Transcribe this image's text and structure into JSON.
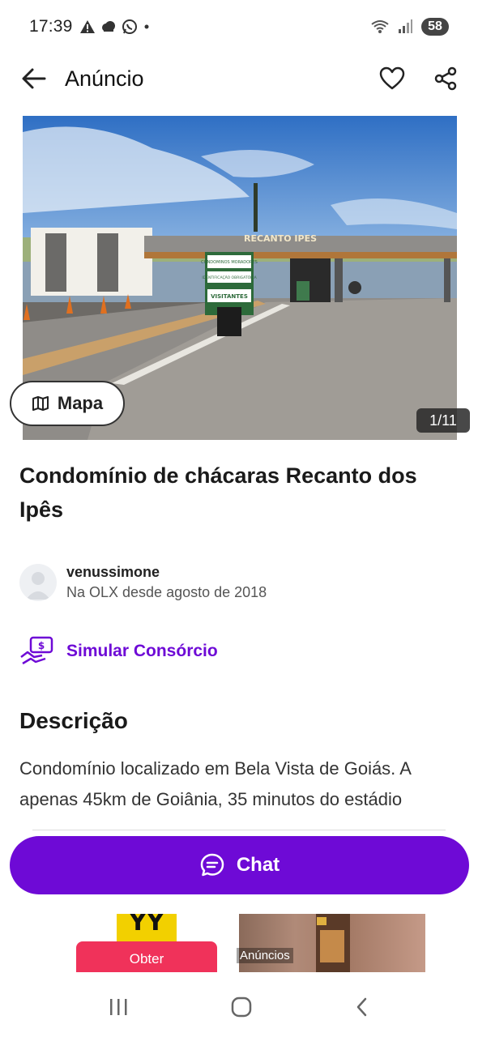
{
  "status_bar": {
    "time": "17:39",
    "battery": "58",
    "icons": [
      "alert-icon",
      "cloud-icon",
      "whatsapp-icon",
      "dot-icon",
      "wifi-icon",
      "signal-icon"
    ]
  },
  "header": {
    "title": "Anúncio",
    "icons": [
      "back-arrow-icon",
      "heart-icon",
      "share-icon"
    ]
  },
  "gallery": {
    "counter": "1/11",
    "map_button": "Mapa",
    "sign_text": "RECANTO IPES",
    "sign_lines": [
      "CONDOMINOS MORADORES",
      "IDENTIFICAÇÃO OBRIGATÓRIA",
      "VISITANTES"
    ]
  },
  "listing": {
    "title": "Condomínio de chácaras Recanto dos Ipês"
  },
  "seller": {
    "name": "venussimone",
    "since": "Na OLX desde agosto de 2018"
  },
  "simular": {
    "label": "Simular Consórcio"
  },
  "description": {
    "heading": "Descrição",
    "text": "Condomínio localizado em Bela Vista de Goiás. A apenas 45km de Goiânia, 35 minutos do estádio"
  },
  "chat_button": {
    "label": "Chat"
  },
  "ad_banner": {
    "obter": "Obter",
    "anuncios": "Anúncios",
    "yellow_text": "YY"
  },
  "colors": {
    "brand_purple": "#6e0ad6",
    "ad_red": "#f0325a",
    "ad_yellow": "#f2d000"
  }
}
